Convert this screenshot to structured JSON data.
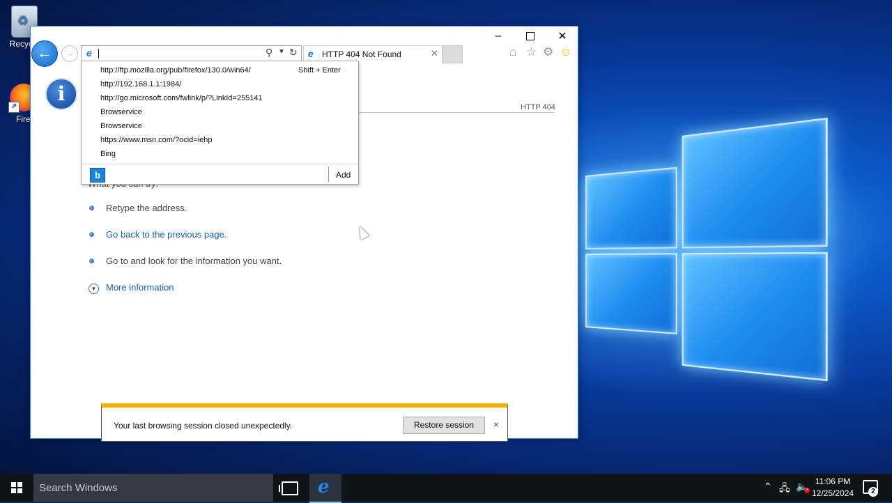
{
  "desktop": {
    "icons": [
      {
        "label": "Recycle"
      },
      {
        "label": "Firef"
      }
    ]
  },
  "browser": {
    "tab_title": "HTTP 404 Not Found",
    "address_value": "",
    "autocomplete": {
      "items": [
        "http://ftp.mozilla.org/pub/firefox/130.0/win64/",
        "http://192.168.1.1:1984/",
        "http://go.microsoft.com/fwlink/p/?LinkId=255141",
        "Browservice",
        "Browservice",
        "https://www.msn.com/?ocid=iehp",
        "Bing"
      ],
      "shortcut_hint": "Shift + Enter",
      "add_label": "Add",
      "provider_icon": "bing-icon"
    },
    "page": {
      "http_code": "HTTP 404",
      "try_text": "What you can try:",
      "bullets": [
        "Retype the address.",
        "Go back to the previous page.",
        "Go to  and look for the information you want."
      ],
      "more_info": "More information"
    },
    "notification": {
      "message": "Your last browsing session closed unexpectedly.",
      "button": "Restore session",
      "close": "×"
    }
  },
  "taskbar": {
    "search_placeholder": "Search Windows",
    "time": "11:06 PM",
    "date": "12/25/2024",
    "notification_count": "2"
  },
  "colors": {
    "accent": "#1a5fa8",
    "notification_border": "#f0b000",
    "taskbar": "#101418"
  }
}
